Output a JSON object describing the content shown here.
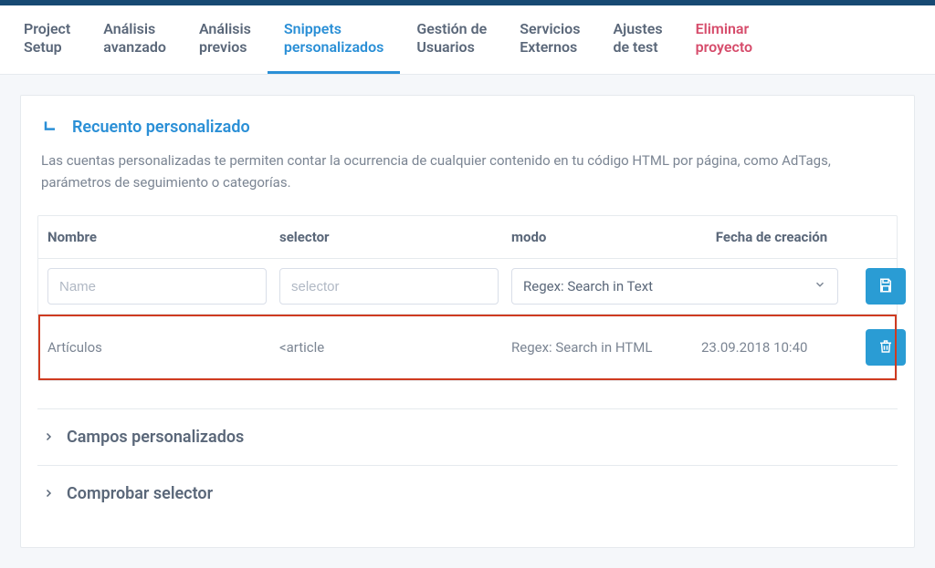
{
  "tabs": [
    {
      "label": "Project\nSetup"
    },
    {
      "label": "Análisis\navanzado"
    },
    {
      "label": "Análisis\nprevios"
    },
    {
      "label": "Snippets\npersonalizados",
      "active": true
    },
    {
      "label": "Gestión de\nUsuarios"
    },
    {
      "label": "Servicios\nExternos"
    },
    {
      "label": "Ajustes\nde test"
    },
    {
      "label": "Eliminar\nproyecto",
      "danger": true
    }
  ],
  "section": {
    "title": "Recuento personalizado",
    "description": "Las cuentas personalizadas te permiten contar la ocurrencia de cualquier contenido en tu código HTML por página, como AdTags, parámetros de seguimiento o categorías."
  },
  "table": {
    "headers": {
      "name": "Nombre",
      "selector": "selector",
      "mode": "modo",
      "date": "Fecha de creación"
    },
    "input_row": {
      "name_placeholder": "Name",
      "selector_placeholder": "selector",
      "mode_value": "Regex: Search in Text"
    },
    "rows": [
      {
        "name": "Artículos",
        "selector": "<article",
        "mode": "Regex: Search in HTML",
        "date": "23.09.2018 10:40"
      }
    ]
  },
  "accordions": [
    {
      "label": "Campos personalizados"
    },
    {
      "label": "Comprobar selector"
    }
  ]
}
